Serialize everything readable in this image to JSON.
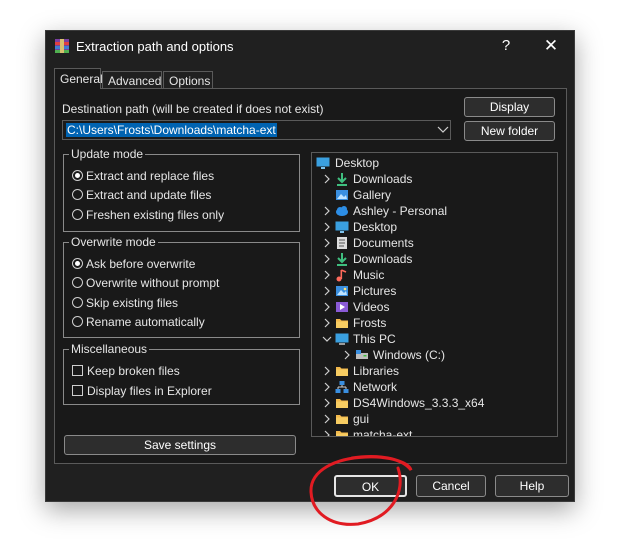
{
  "window": {
    "title": "Extraction path and options",
    "help": "?",
    "close": "✕"
  },
  "tabs": [
    {
      "label": "General"
    },
    {
      "label": "Advanced"
    },
    {
      "label": "Options"
    }
  ],
  "destination": {
    "label": "Destination path (will be created if does not exist)",
    "value": "C:\\Users\\Frosts\\Downloads\\matcha-ext",
    "display_button": "Display",
    "new_folder_button": "New folder"
  },
  "update_mode": {
    "title": "Update mode",
    "options": [
      "Extract and replace files",
      "Extract and update files",
      "Freshen existing files only"
    ],
    "selected": 0
  },
  "overwrite_mode": {
    "title": "Overwrite mode",
    "options": [
      "Ask before overwrite",
      "Overwrite without prompt",
      "Skip existing files",
      "Rename automatically"
    ],
    "selected": 0
  },
  "misc": {
    "title": "Miscellaneous",
    "options": [
      "Keep broken files",
      "Display files in Explorer"
    ]
  },
  "save_settings": "Save settings",
  "tree": {
    "root": "Desktop",
    "items": [
      {
        "label": "Downloads",
        "icon": "download-arrow-icon"
      },
      {
        "label": "Gallery",
        "icon": "gallery-icon"
      },
      {
        "label": "Ashley - Personal",
        "icon": "cloud-icon"
      },
      {
        "label": "Desktop",
        "icon": "desktop-icon"
      },
      {
        "label": "Documents",
        "icon": "documents-icon"
      },
      {
        "label": "Downloads",
        "icon": "download-arrow-icon"
      },
      {
        "label": "Music",
        "icon": "music-icon"
      },
      {
        "label": "Pictures",
        "icon": "pictures-icon"
      },
      {
        "label": "Videos",
        "icon": "videos-icon"
      },
      {
        "label": "Frosts",
        "icon": "folder-icon"
      },
      {
        "label": "This PC",
        "icon": "computer-icon"
      },
      {
        "label": "Windows (C:)",
        "icon": "drive-icon"
      },
      {
        "label": "Libraries",
        "icon": "folder-icon"
      },
      {
        "label": "Network",
        "icon": "network-icon"
      },
      {
        "label": "DS4Windows_3.3.3_x64",
        "icon": "folder-icon"
      },
      {
        "label": "gui",
        "icon": "folder-icon"
      },
      {
        "label": "matcha-ext",
        "icon": "folder-icon"
      }
    ]
  },
  "footer": {
    "ok": "OK",
    "cancel": "Cancel",
    "help": "Help"
  },
  "colors": {
    "accent": "#0063b1",
    "annotation": "#e11b22",
    "folder": "#f2b84b"
  }
}
